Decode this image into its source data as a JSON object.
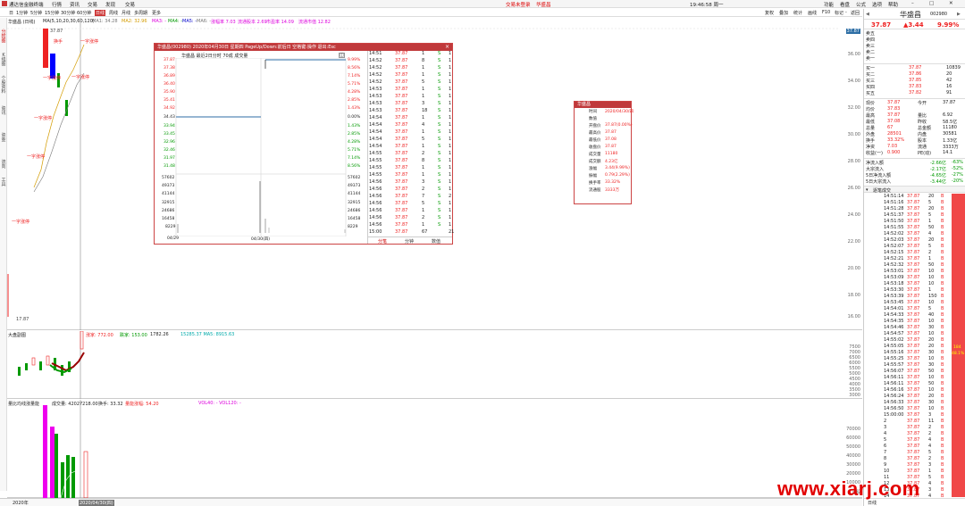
{
  "titlebar": {
    "app": "通达信金融终端",
    "menus": [
      "行情",
      "资讯",
      "交易",
      "发现",
      "交易"
    ],
    "center_links": [
      "交易未登录",
      "华盛昌"
    ],
    "clock": "19:46:58 周一",
    "right_menus": [
      "功能",
      "看盘",
      "公式",
      "选项",
      "帮助"
    ]
  },
  "toolbar": {
    "periods": [
      "日",
      "1分钟",
      "5分钟",
      "15分钟",
      "30分钟",
      "60分钟",
      "日线",
      "周线",
      "月线",
      "多周期",
      "更多"
    ],
    "right_btns": [
      "复权",
      "叠加",
      "统计",
      "画线",
      "F10",
      "标记",
      "-",
      "返回"
    ]
  },
  "main": {
    "stock_label": "华盛昌 (日线)",
    "ma_legend": [
      "MA(5,10,20,30,60,120)",
      "MA1: 34.28",
      "MA2: 32.96",
      "MA3: -",
      "MA4: -",
      "MA5: -",
      "MA6: -"
    ],
    "ma_extra": [
      "涨幅率 7.03",
      "流通股本 2.69",
      "市盈率 14.09",
      "流通市值 12.82"
    ],
    "annotations": [
      "换手",
      "一字涨停",
      "一字涨停",
      "一字涨停",
      "一字涨停",
      "一字涨停",
      "一字涨停",
      "一字涨停",
      "一字涨停",
      "一字涨停",
      "一字涨停"
    ],
    "price_high": "37.87",
    "price_low": "17.87",
    "yaxis": [
      "37.87",
      "36.00",
      "34.00",
      "32.00",
      "30.00",
      "28.00",
      "26.00",
      "24.00",
      "22.00",
      "20.00",
      "18.00",
      "16.00"
    ],
    "dates": [
      "2020年",
      "2020/04/30(四)"
    ]
  },
  "sub1": {
    "label": "大盘副图",
    "legend": [
      "涨家: 772.00",
      "跌家: 153.00",
      "1782.26",
      "15285.37 MA5: 8915.63"
    ],
    "yaxis": [
      "7500",
      "7000",
      "6500",
      "6000",
      "5500",
      "5000",
      "4500",
      "4000",
      "3500",
      "3000"
    ]
  },
  "sub2": {
    "label": "量比均线涨量能",
    "legend": [
      "成交量: 42027218.00",
      "换手: 33.32",
      "量能涨幅: 54.20"
    ],
    "legend2": "VOL40: - VOL120: -",
    "yaxis": [
      "70000",
      "60000",
      "50000",
      "40000",
      "30000",
      "20000",
      "10000",
      "万股"
    ]
  },
  "popup": {
    "title": "华盛昌(002980) 2020年04月30日 星期四 PageUp/Down:前后日 空格键:操作 退出:Esc",
    "subtitle": "华盛昌 最近2日分时 70成 成交量",
    "price_labels": [
      "37.87",
      "37.38",
      "36.89",
      "36.40",
      "35.90",
      "35.41",
      "34.92",
      "34.43",
      "33.94",
      "33.45",
      "32.96",
      "32.46",
      "31.97",
      "31.48"
    ],
    "pct_labels": [
      "9.99%",
      "8.56%",
      "7.14%",
      "5.71%",
      "4.28%",
      "2.85%",
      "1.43%",
      "0.00%",
      "1.43%",
      "2.85%",
      "4.28%",
      "5.71%",
      "7.14%",
      "8.56%"
    ],
    "vol_labels": [
      "57602",
      "49373",
      "41144",
      "32915",
      "24686",
      "16458",
      "8229"
    ],
    "dates": [
      "04/29",
      "04/30(四)"
    ],
    "ticks": [
      [
        "14:51",
        "37.87",
        "1",
        "S",
        "1"
      ],
      [
        "14:52",
        "37.87",
        "8",
        "S",
        "1"
      ],
      [
        "14:52",
        "37.87",
        "1",
        "S",
        "1"
      ],
      [
        "14:52",
        "37.87",
        "1",
        "S",
        "1"
      ],
      [
        "14:52",
        "37.87",
        "5",
        "S",
        "1"
      ],
      [
        "14:53",
        "37.87",
        "1",
        "S",
        "1"
      ],
      [
        "14:53",
        "37.87",
        "1",
        "S",
        "1"
      ],
      [
        "14:53",
        "37.87",
        "3",
        "S",
        "1"
      ],
      [
        "14:53",
        "37.87",
        "18",
        "S",
        "1"
      ],
      [
        "14:54",
        "37.87",
        "1",
        "S",
        "1"
      ],
      [
        "14:54",
        "37.87",
        "4",
        "S",
        "1"
      ],
      [
        "14:54",
        "37.87",
        "1",
        "S",
        "1"
      ],
      [
        "14:54",
        "37.87",
        "5",
        "S",
        "1"
      ],
      [
        "14:54",
        "37.87",
        "1",
        "S",
        "1"
      ],
      [
        "14:55",
        "37.87",
        "2",
        "S",
        "1"
      ],
      [
        "14:55",
        "37.87",
        "8",
        "S",
        "1"
      ],
      [
        "14:55",
        "37.87",
        "1",
        "S",
        "1"
      ],
      [
        "14:55",
        "37.87",
        "1",
        "S",
        "1"
      ],
      [
        "14:56",
        "37.87",
        "3",
        "S",
        "1"
      ],
      [
        "14:56",
        "37.87",
        "2",
        "S",
        "1"
      ],
      [
        "14:56",
        "37.87",
        "7",
        "S",
        "2"
      ],
      [
        "14:56",
        "37.87",
        "5",
        "S",
        "1"
      ],
      [
        "14:56",
        "37.87",
        "1",
        "S",
        "1"
      ],
      [
        "14:56",
        "37.87",
        "2",
        "S",
        "1"
      ],
      [
        "14:56",
        "37.87",
        "1",
        "S",
        "1"
      ],
      [
        "15:00",
        "37.87",
        "67",
        "",
        "21"
      ]
    ],
    "tick_tabs": [
      "分笔",
      "分钟",
      "数值"
    ]
  },
  "info": {
    "title": "华盛昌",
    "rows": [
      [
        "时间",
        "2020/04/30/四"
      ],
      [
        "数值",
        ""
      ],
      [
        "开盘价",
        "37.87(0.00%)"
      ],
      [
        "最高价",
        "37.87"
      ],
      [
        "最低价",
        "37.08"
      ],
      [
        "收盘价",
        "37.87"
      ],
      [
        "成交量",
        "11180"
      ],
      [
        "成交额",
        "4.23亿"
      ],
      [
        "涨幅",
        "3.44(9.99%)"
      ],
      [
        "振幅",
        "0.79(2.29%)"
      ],
      [
        "换手率",
        "33.32%"
      ],
      [
        "流通股",
        "3333万"
      ]
    ]
  },
  "panel": {
    "name": "华盛昌",
    "code": "002980",
    "price": "37.87",
    "change": "▲3.44",
    "pct": "9.99%",
    "asks": [
      [
        "卖五",
        "",
        ""
      ],
      [
        "卖四",
        "",
        ""
      ],
      [
        "卖三",
        "",
        ""
      ],
      [
        "卖二",
        "",
        ""
      ],
      [
        "卖一",
        "",
        ""
      ]
    ],
    "bids": [
      [
        "买一",
        "37.87",
        "10839"
      ],
      [
        "买二",
        "37.86",
        "20"
      ],
      [
        "买三",
        "37.85",
        "42"
      ],
      [
        "买四",
        "37.83",
        "16"
      ],
      [
        "买五",
        "37.82",
        "91"
      ]
    ],
    "stats": [
      [
        "现价",
        "37.87",
        "今开",
        "37.87"
      ],
      [
        "均价",
        "37.83",
        ""
      ],
      [
        "最高",
        "37.87",
        "量比",
        "6.92"
      ],
      [
        "最低",
        "37.08",
        "昨收",
        "58.5亿"
      ],
      [
        "总量",
        "67",
        "总金额",
        "11180"
      ],
      [
        "外盘",
        "28501",
        "内盘",
        "30581"
      ],
      [
        "换手",
        "33.32%",
        "股本",
        "1.33亿"
      ],
      [
        "净资",
        "7.03",
        "流通",
        "3333万"
      ],
      [
        "收益(一)",
        "0.900",
        "PE(动)",
        "14.1"
      ]
    ],
    "flows": [
      [
        "净流入额",
        "-2.66亿",
        "-63%"
      ],
      [
        "大宗流入",
        "-2.17亿",
        "-52%"
      ],
      [
        "5日净流入额",
        "-4.65亿",
        "-27%"
      ],
      [
        "5日大宗流入",
        "-3.44亿",
        "-20%"
      ]
    ],
    "trades_title": "逐笔成交",
    "trades": [
      [
        "14:51:14",
        "37.87",
        "20"
      ],
      [
        "14:51:16",
        "37.87",
        "5"
      ],
      [
        "14:51:28",
        "37.87",
        "20"
      ],
      [
        "14:51:37",
        "37.87",
        "5"
      ],
      [
        "14:51:50",
        "37.87",
        "1"
      ],
      [
        "14:51:55",
        "37.87",
        "50"
      ],
      [
        "14:52:02",
        "37.87",
        "4"
      ],
      [
        "14:52:03",
        "37.87",
        "20"
      ],
      [
        "14:52:07",
        "37.87",
        "5"
      ],
      [
        "14:52:15",
        "37.87",
        "2"
      ],
      [
        "14:52:21",
        "37.87",
        "1"
      ],
      [
        "14:52:32",
        "37.87",
        "50"
      ],
      [
        "14:53:01",
        "37.87",
        "10"
      ],
      [
        "14:53:09",
        "37.87",
        "10"
      ],
      [
        "14:53:18",
        "37.87",
        "10"
      ],
      [
        "14:53:30",
        "37.87",
        "1"
      ],
      [
        "14:53:39",
        "37.87",
        "150"
      ],
      [
        "14:53:45",
        "37.87",
        "10"
      ],
      [
        "14:54:01",
        "37.87",
        "5"
      ],
      [
        "14:54:33",
        "37.87",
        "40"
      ],
      [
        "14:54:35",
        "37.87",
        "10"
      ],
      [
        "14:54:46",
        "37.87",
        "30"
      ],
      [
        "14:54:57",
        "37.87",
        "10"
      ],
      [
        "14:55:02",
        "37.87",
        "20"
      ],
      [
        "14:55:05",
        "37.87",
        "20"
      ],
      [
        "14:55:16",
        "37.87",
        "30"
      ],
      [
        "14:55:25",
        "37.87",
        "10"
      ],
      [
        "14:55:57",
        "37.87",
        "30"
      ],
      [
        "14:56:07",
        "37.87",
        "50"
      ],
      [
        "14:56:11",
        "37.87",
        "10"
      ],
      [
        "14:56:11",
        "37.87",
        "50"
      ],
      [
        "14:56:16",
        "37.87",
        "10"
      ],
      [
        "14:56:24",
        "37.87",
        "20"
      ],
      [
        "14:56:33",
        "37.87",
        "30"
      ],
      [
        "14:56:50",
        "37.87",
        "10"
      ],
      [
        "15:00:00",
        "37.87",
        "3"
      ],
      [
        "2",
        "37.87",
        "11"
      ],
      [
        "3",
        "37.87",
        "2"
      ],
      [
        "4",
        "37.87",
        "2"
      ],
      [
        "5",
        "37.87",
        "4"
      ],
      [
        "6",
        "37.87",
        "4"
      ],
      [
        "7",
        "37.87",
        "5"
      ],
      [
        "8",
        "37.87",
        "2"
      ],
      [
        "9",
        "37.87",
        "3"
      ],
      [
        "10",
        "37.87",
        "1"
      ],
      [
        "11",
        "37.87",
        "5"
      ],
      [
        "12",
        "37.87",
        "4"
      ],
      [
        "13",
        "37.87",
        "3"
      ],
      [
        "14",
        "37.87",
        "4"
      ]
    ],
    "bar_label": [
      "184",
      "48.1%"
    ],
    "footer": "日线"
  },
  "bottom": [
    "2020年",
    "2020/04/30(四)"
  ],
  "watermark": "www.xiarj.com"
}
